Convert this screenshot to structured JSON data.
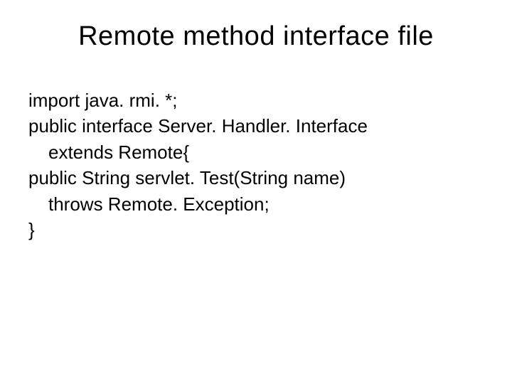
{
  "slide": {
    "title": "Remote method interface file",
    "code": {
      "line1": "import java. rmi. *;",
      "line2": "public interface Server. Handler. Interface",
      "line3": "extends Remote{",
      "line4": "public String servlet. Test(String name)",
      "line5": "throws Remote. Exception;",
      "line6": "}"
    }
  }
}
